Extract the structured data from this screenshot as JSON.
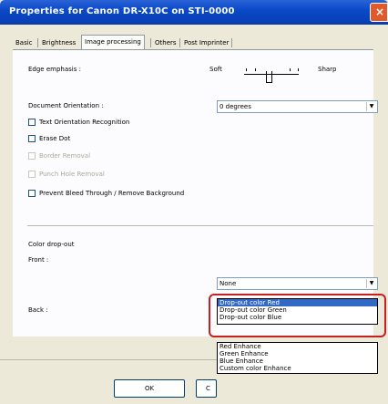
{
  "window": {
    "title": "Properties for Canon DR-X10C on STI-0000",
    "close_glyph": "×"
  },
  "tabs": [
    {
      "label": "Basic"
    },
    {
      "label": "Brightness"
    },
    {
      "label": "Image processing"
    },
    {
      "label": "Others"
    },
    {
      "label": "Post Imprinter"
    }
  ],
  "edge_emphasis": {
    "label": "Edge emphasis :",
    "soft": "Soft",
    "sharp": "Sharp"
  },
  "orientation": {
    "label": "Document Orientation :",
    "value": "0 degrees",
    "arrow": "▼"
  },
  "checkboxes": [
    {
      "label": "Text Orientation Recognition",
      "enabled": true
    },
    {
      "label": "Erase Dot",
      "enabled": true
    },
    {
      "label": "Border Removal",
      "enabled": false
    },
    {
      "label": "Punch Hole Removal",
      "enabled": false
    },
    {
      "label": "Prevent Bleed Through / Remove Background",
      "enabled": true
    }
  ],
  "color_dropout": {
    "label": "Color drop-out",
    "front_label": "Front :",
    "front_value": "None",
    "back_label": "Back :",
    "dropout_options": [
      "Drop-out color Red",
      "Drop-out color Green",
      "Drop-out color Blue"
    ],
    "selected_index": 0,
    "enhance_options": [
      "Red Enhance",
      "Green Enhance",
      "Blue Enhance",
      "Custom color Enhance"
    ]
  },
  "buttons": {
    "ok": "OK",
    "cancel_partial": "C"
  },
  "colors": {
    "title_bar": "#0a49c9",
    "highlight": "#c8201e",
    "selection": "#316ac5"
  }
}
